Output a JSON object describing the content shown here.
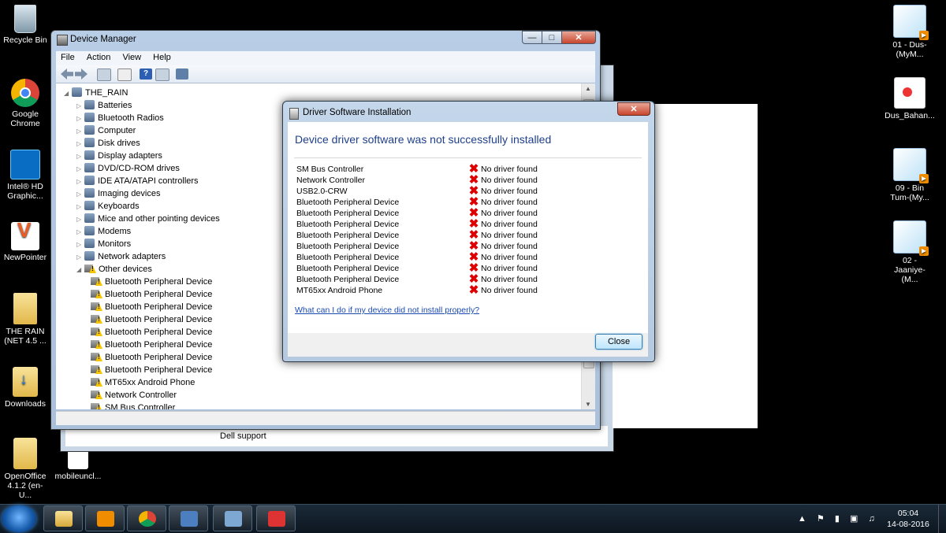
{
  "desktop": {
    "left_icons": [
      {
        "label": "Recycle Bin"
      },
      {
        "label": "Google Chrome"
      },
      {
        "label": "Intel® HD Graphic..."
      },
      {
        "label": "NewPointer"
      },
      {
        "label": "THE RAIN (NET 4.5 ..."
      },
      {
        "label": "Downloads"
      },
      {
        "label": "OpenOffice 4.1.2 (en-U..."
      },
      {
        "label": "mobileuncl..."
      }
    ],
    "right_icons": [
      {
        "label": "01 - Dus-(MyM..."
      },
      {
        "label": "Dus_Bahan..."
      },
      {
        "label": "09 - Bin Tum-(My..."
      },
      {
        "label": "02 - Jaaniye-(M..."
      }
    ]
  },
  "background_window": {
    "visible_text_1": "Dell support"
  },
  "device_manager": {
    "title": "Device Manager",
    "menu": [
      "File",
      "Action",
      "View",
      "Help"
    ],
    "tree": {
      "root": "THE_RAIN",
      "categories": [
        "Batteries",
        "Bluetooth Radios",
        "Computer",
        "Disk drives",
        "Display adapters",
        "DVD/CD-ROM drives",
        "IDE ATA/ATAPI controllers",
        "Imaging devices",
        "Keyboards",
        "Mice and other pointing devices",
        "Modems",
        "Monitors",
        "Network adapters",
        "Other devices"
      ],
      "other_devices": [
        "Bluetooth Peripheral Device",
        "Bluetooth Peripheral Device",
        "Bluetooth Peripheral Device",
        "Bluetooth Peripheral Device",
        "Bluetooth Peripheral Device",
        "Bluetooth Peripheral Device",
        "Bluetooth Peripheral Device",
        "Bluetooth Peripheral Device",
        "MT65xx Android Phone",
        "Network Controller",
        "SM Bus Controller"
      ]
    }
  },
  "dialog": {
    "title": "Driver Software Installation",
    "heading": "Device driver software was not successfully installed",
    "devices": [
      {
        "name": "SM Bus Controller",
        "status": "No driver found"
      },
      {
        "name": "Network Controller",
        "status": "No driver found"
      },
      {
        "name": "USB2.0-CRW",
        "status": "No driver found"
      },
      {
        "name": "Bluetooth Peripheral Device",
        "status": "No driver found"
      },
      {
        "name": "Bluetooth Peripheral Device",
        "status": "No driver found"
      },
      {
        "name": "Bluetooth Peripheral Device",
        "status": "No driver found"
      },
      {
        "name": "Bluetooth Peripheral Device",
        "status": "No driver found"
      },
      {
        "name": "Bluetooth Peripheral Device",
        "status": "No driver found"
      },
      {
        "name": "Bluetooth Peripheral Device",
        "status": "No driver found"
      },
      {
        "name": "Bluetooth Peripheral Device",
        "status": "No driver found"
      },
      {
        "name": "Bluetooth Peripheral Device",
        "status": "No driver found"
      },
      {
        "name": "MT65xx Android Phone",
        "status": "No driver found"
      }
    ],
    "help_link": "What can I do if my device did not install properly?",
    "close_button": "Close"
  },
  "taskbar": {
    "time": "05:04",
    "date": "14-08-2016"
  },
  "colors": {
    "heading_blue": "#1e3f8a",
    "link_blue": "#1a4bb0",
    "error_red": "#dd0000"
  }
}
